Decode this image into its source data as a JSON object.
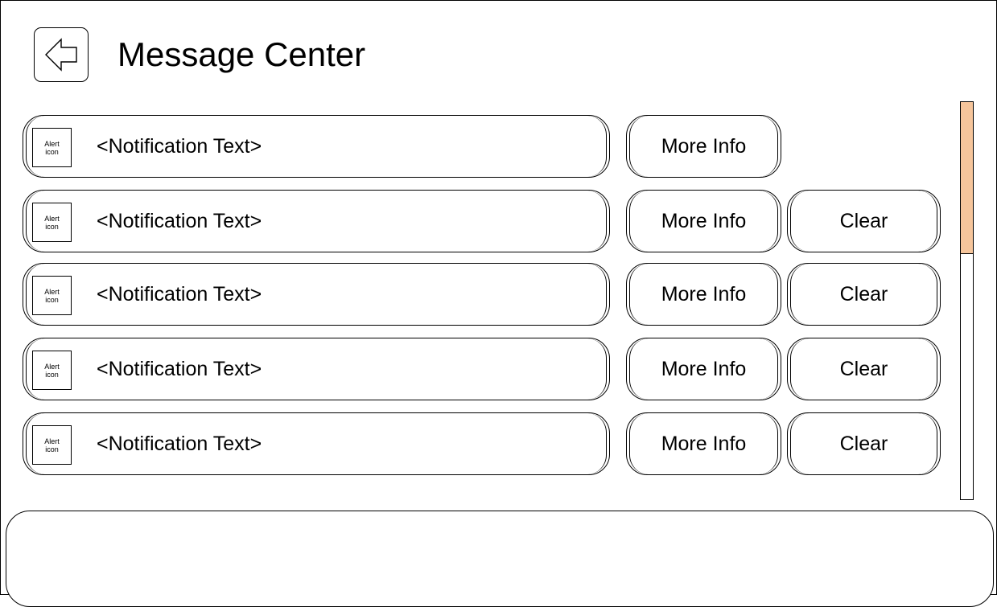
{
  "header": {
    "title": "Message Center",
    "back_icon": "arrow-left-icon"
  },
  "alert_icon": {
    "line1": "Alert",
    "line2": "icon"
  },
  "buttons": {
    "more_info": "More Info",
    "clear": "Clear"
  },
  "notifications": [
    {
      "text": "<Notification Text>",
      "has_clear": false
    },
    {
      "text": "<Notification Text>",
      "has_clear": true
    },
    {
      "text": "<Notification Text>",
      "has_clear": true
    },
    {
      "text": "<Notification Text>",
      "has_clear": true
    },
    {
      "text": "<Notification Text>",
      "has_clear": true
    }
  ],
  "scrollbar": {
    "thumb_color": "#f6c59b"
  }
}
